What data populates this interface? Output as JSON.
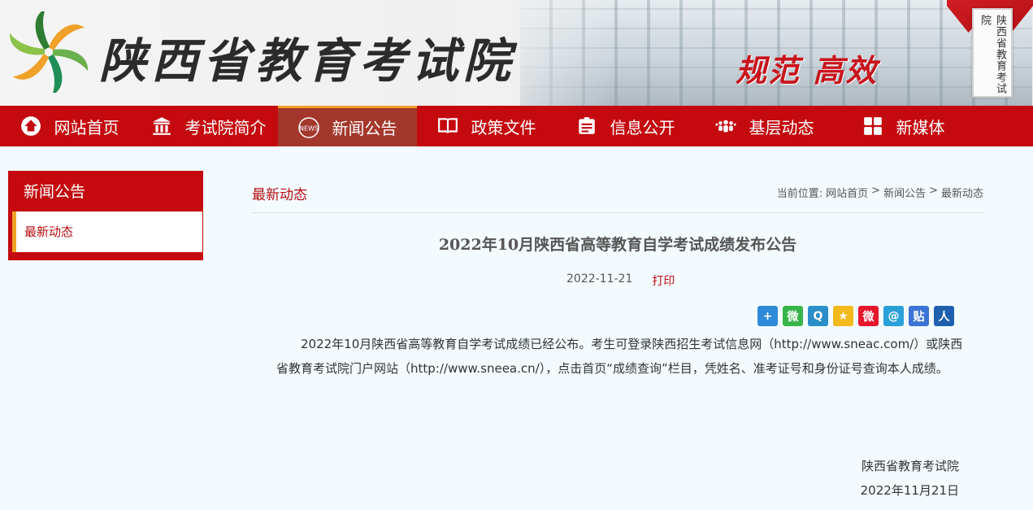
{
  "header": {
    "site_title": "陕西省教育考试院",
    "slogan": "规范 高效",
    "plaque_text": "陕西省教育考试院"
  },
  "nav": {
    "items": [
      {
        "label": "网站首页",
        "icon": "home-icon"
      },
      {
        "label": "考试院简介",
        "icon": "institution-icon"
      },
      {
        "label": "新闻公告",
        "icon": "news-icon",
        "badge": "NEWS",
        "active": true
      },
      {
        "label": "政策文件",
        "icon": "book-icon"
      },
      {
        "label": "信息公开",
        "icon": "id-card-icon"
      },
      {
        "label": "基层动态",
        "icon": "people-icon"
      },
      {
        "label": "新媒体",
        "icon": "grid-icon"
      }
    ]
  },
  "sidebar": {
    "title": "新闻公告",
    "items": [
      {
        "label": "最新动态"
      }
    ]
  },
  "content": {
    "section_title": "最新动态",
    "breadcrumb": {
      "prefix": "当前位置:",
      "items": [
        "网站首页",
        "新闻公告",
        "最新动态"
      ],
      "separator": ">"
    },
    "article": {
      "title": "2022年10月陕西省高等教育自学考试成绩发布公告",
      "date": "2022-11-21",
      "print_label": "打印",
      "body": "2022年10月陕西省高等教育自学考试成绩已经公布。考生可登录陕西招生考试信息网（http://www.sneac.com/）或陕西省教育考试院门户网站（http://www.sneea.cn/），点击首页“成绩查询”栏目，凭姓名、准考证号和身份证号查询本人成绩。",
      "signature": "陕西省教育考试院",
      "signature_date": "2022年11月21日"
    },
    "share_buttons": [
      {
        "name": "share-more-icon",
        "glyph": "+",
        "color": "#2f8ad7"
      },
      {
        "name": "wechat-icon",
        "glyph": "微",
        "color": "#38b54a"
      },
      {
        "name": "qq-icon",
        "glyph": "Q",
        "color": "#2a8ec8"
      },
      {
        "name": "qzone-icon",
        "glyph": "★",
        "color": "#f3b81a"
      },
      {
        "name": "weibo-icon",
        "glyph": "微",
        "color": "#e6162d"
      },
      {
        "name": "tencent-weibo-icon",
        "glyph": "@",
        "color": "#2aa0d8"
      },
      {
        "name": "tieba-icon",
        "glyph": "贴",
        "color": "#3a74d6"
      },
      {
        "name": "renren-icon",
        "glyph": "人",
        "color": "#1f5fae"
      }
    ]
  },
  "colors": {
    "nav_bg": "#c40a0f",
    "nav_active_bg": "#a4372c",
    "accent_orange": "#f0a12a",
    "link_red": "#b80c10",
    "page_bg": "#f3fbfe"
  }
}
